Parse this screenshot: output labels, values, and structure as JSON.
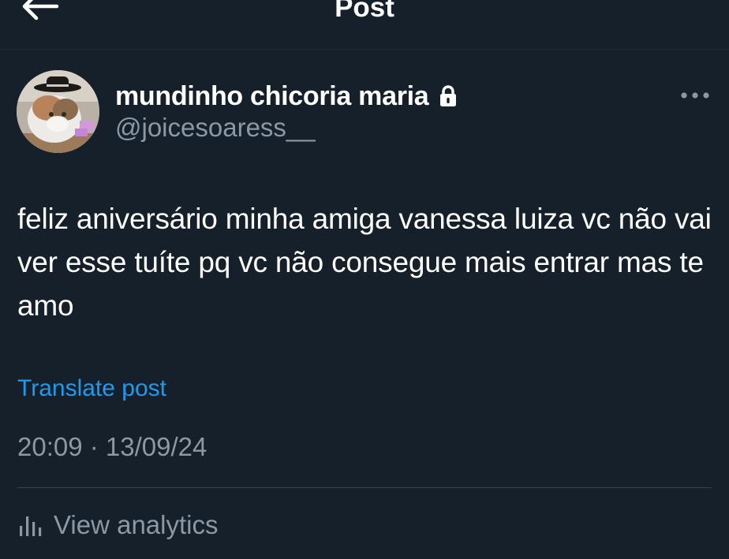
{
  "header": {
    "title": "Post",
    "back_icon": "arrow-left-icon"
  },
  "author": {
    "display_name": "mundinho chicoria maria",
    "handle": "@joicesoaress__",
    "protected_icon": "lock-icon",
    "avatar": "cat-with-cowboy-hat-avatar"
  },
  "post": {
    "text": "feliz aniversário minha amiga vanessa luiza vc não vai ver esse tuíte pq vc não consegue mais entrar mas te amo",
    "translate_label": "Translate post",
    "timestamp": "20:09 · 13/09/24"
  },
  "actions": {
    "more_icon": "more-horizontal-icon",
    "analytics_label": "View analytics",
    "analytics_icon": "bar-chart-icon"
  },
  "colors": {
    "background": "#15202b",
    "primary_text": "#ffffff",
    "secondary_text": "#8b98a5",
    "accent": "#1d9bf0",
    "divider": "#38444d"
  }
}
